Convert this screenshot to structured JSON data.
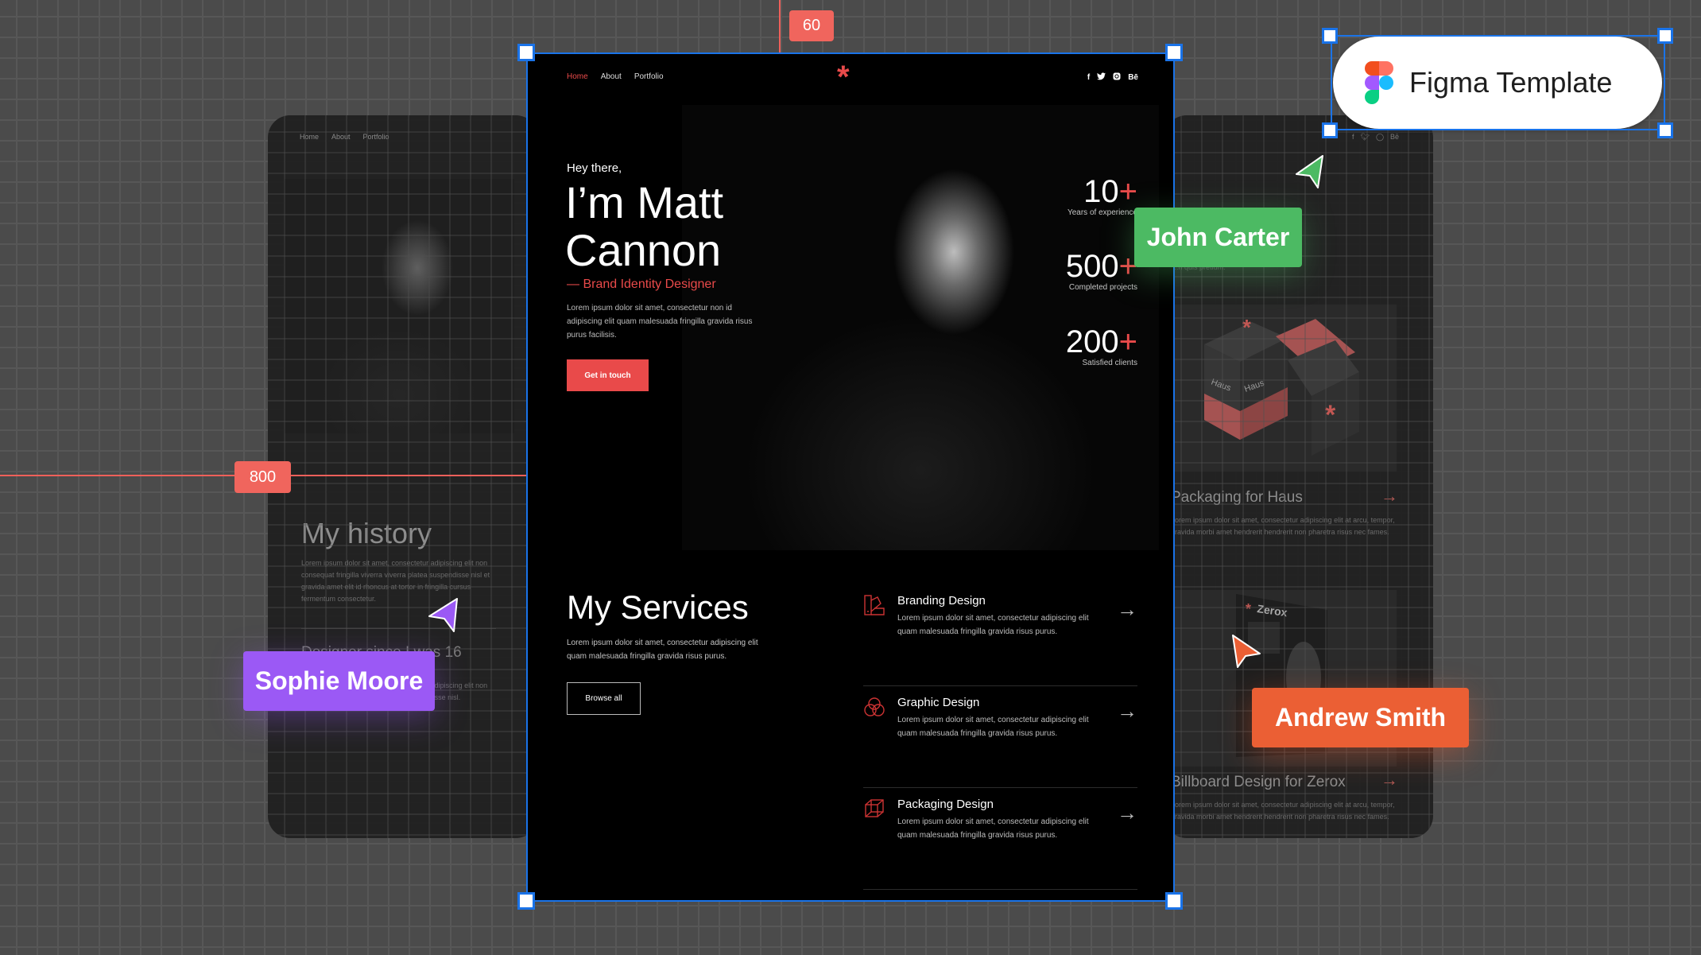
{
  "canvas": {
    "measurements": {
      "top_offset": "60",
      "width": "800"
    },
    "badge": {
      "label": "Figma Template",
      "icon": "figma-logo-icon"
    },
    "collaborators": [
      {
        "name": "John Carter",
        "color": "#4cba63"
      },
      {
        "name": "Sophie Moore",
        "color": "#9b59f5"
      },
      {
        "name": "Andrew Smith",
        "color": "#eb5f34"
      }
    ]
  },
  "left_card": {
    "nav": [
      "Home",
      "About",
      "Portfolio"
    ],
    "history_title": "My history",
    "history_text": "Lorem ipsum dolor sit amet, consectetur adipiscing elit non consequat fringilla viverra viverra platea suspendisse nisl et gravida amet elit id rhoncus at tortor in fringilla cursus fermentum consectetur.",
    "history_subtitle": "Designer since I was 16",
    "history_subtext": "Lorem ipsum dolor sit amet, consectetur adipiscing elit non consequat fringilla viverra platea suspendisse nisl."
  },
  "main_card": {
    "nav": {
      "items": [
        {
          "label": "Home",
          "active": true
        },
        {
          "label": "About",
          "active": false
        },
        {
          "label": "Portfolio",
          "active": false
        }
      ],
      "logo": "*",
      "social": [
        "f",
        "t",
        "ig",
        "Bē"
      ]
    },
    "hero": {
      "greeting": "Hey there,",
      "name_line1": "I’m Matt",
      "name_line2": "Cannon",
      "role": "— Brand Identity Designer",
      "text": "Lorem ipsum dolor sit amet, consectetur non id adipiscing elit quam malesuada fringilla gravida risus purus facilisis.",
      "cta": "Get in touch"
    },
    "stats": [
      {
        "value": "10",
        "suffix": "+",
        "label": "Years of experience"
      },
      {
        "value": "500",
        "suffix": "+",
        "label": "Completed projects"
      },
      {
        "value": "200",
        "suffix": "+",
        "label": "Satisfied clients"
      }
    ],
    "services": {
      "title": "My Services",
      "text": "Lorem ipsum dolor sit amet, consectetur adipiscing elit quam malesuada fringilla gravida risus purus.",
      "button": "Browse all",
      "items": [
        {
          "name": "Branding Design",
          "desc": "Lorem ipsum dolor sit amet, consectetur adipiscing elit quam malesuada fringilla gravida risus purus.",
          "icon": "swatch-icon"
        },
        {
          "name": "Graphic Design",
          "desc": "Lorem ipsum dolor sit amet, consectetur adipiscing elit quam malesuada fringilla gravida risus purus.",
          "icon": "venn-circles-icon"
        },
        {
          "name": "Packaging Design",
          "desc": "Lorem ipsum dolor sit amet, consectetur adipiscing elit quam malesuada fringilla gravida risus purus.",
          "icon": "cube-icon"
        }
      ]
    }
  },
  "right_card": {
    "social": [
      "f",
      "t",
      "ig",
      "Bē"
    ],
    "snippet": "...n quis pretium.",
    "portfolio": [
      {
        "title": "Packaging for Haus",
        "text": "Lorem ipsum dolor sit amet, consectetur adipiscing elit at arcu, tempor, gravida morbi amet hendrerit hendrerit non pharetra risus nec fames.",
        "image_label": "Haus"
      },
      {
        "title": "Billboard Design for Zerox",
        "text": "Lorem ipsum dolor sit amet, consectetur adipiscing elit at arcu, tempor, gravida morbi amet hendrerit hendrerit non pharetra risus nec fames.",
        "image_label": "Zerox"
      }
    ]
  },
  "colors": {
    "accent": "#e94a4a",
    "selection": "#1a73e8",
    "measure": "#f0605a"
  }
}
